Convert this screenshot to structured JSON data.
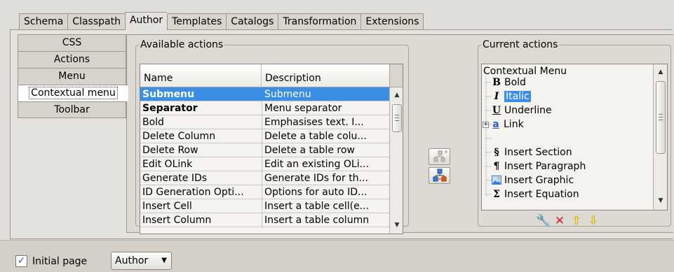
{
  "tabs": [
    "Schema",
    "Classpath",
    "Author",
    "Templates",
    "Catalogs",
    "Transformation",
    "Extensions"
  ],
  "active_tab": "Author",
  "side_items": [
    "CSS",
    "Actions",
    "Menu",
    "Contextual menu",
    "Toolbar"
  ],
  "available": {
    "legend": "Available actions",
    "col_name": "Name",
    "col_desc": "Description",
    "rows": [
      {
        "name": "Submenu",
        "desc": "Submenu"
      },
      {
        "name": "Separator",
        "desc": "Menu separator"
      },
      {
        "name": "Bold",
        "desc": "Emphasises text. I..."
      },
      {
        "name": "Delete Column",
        "desc": "Delete a table colu..."
      },
      {
        "name": "Delete Row",
        "desc": "Delete a table row"
      },
      {
        "name": "Edit OLink",
        "desc": "Edit an existing OLi..."
      },
      {
        "name": "Generate IDs",
        "desc": "Generate IDs for th..."
      },
      {
        "name": "ID Generation Opti...",
        "desc": "Options for auto ID..."
      },
      {
        "name": "Insert Cell",
        "desc": "Insert a table cell(e..."
      },
      {
        "name": "Insert Column",
        "desc": "Insert a table column"
      }
    ]
  },
  "current": {
    "legend": "Current actions",
    "root": "Contextual Menu",
    "items": [
      {
        "icon": "B",
        "label": "Bold"
      },
      {
        "icon": "I",
        "label": "Italic"
      },
      {
        "icon": "U",
        "label": "Underline"
      },
      {
        "icon": "a",
        "label": "Link"
      },
      {
        "icon": "§",
        "label": "Insert Section"
      },
      {
        "icon": "¶",
        "label": "Insert Paragraph"
      },
      {
        "icon": "img",
        "label": "Insert Graphic"
      },
      {
        "icon": "Σ",
        "label": "Insert Equation"
      }
    ]
  },
  "bottom": {
    "initial_page_label": "Initial page",
    "initial_page_checked": true,
    "initial_page_value": "Author"
  },
  "colors": {
    "selection": "#3a8ee6",
    "delete": "#e02020",
    "arrow": "#e8b800"
  }
}
